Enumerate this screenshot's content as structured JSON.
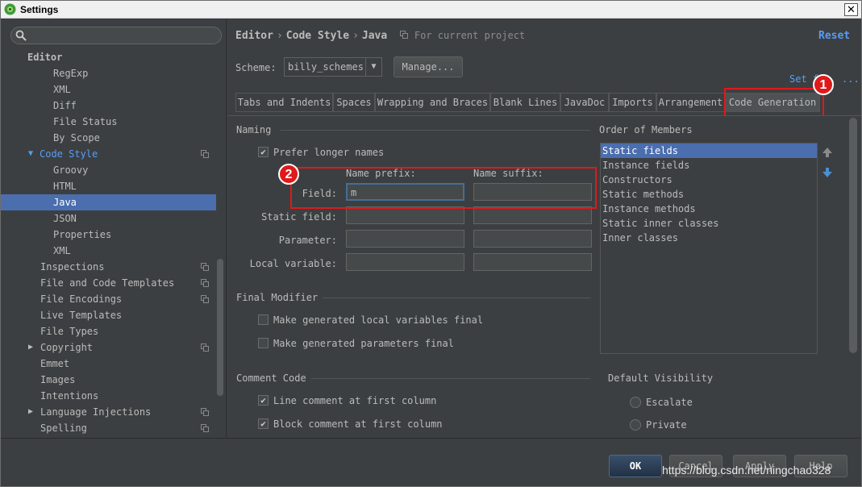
{
  "window": {
    "title": "Settings"
  },
  "search": {
    "placeholder": ""
  },
  "sidebar": {
    "items": [
      {
        "label": "Editor"
      },
      {
        "label": "RegExp"
      },
      {
        "label": "XML"
      },
      {
        "label": "Diff"
      },
      {
        "label": "File Status"
      },
      {
        "label": "By Scope"
      },
      {
        "label": "Code Style"
      },
      {
        "label": "Groovy"
      },
      {
        "label": "HTML"
      },
      {
        "label": "Java"
      },
      {
        "label": "JSON"
      },
      {
        "label": "Properties"
      },
      {
        "label": "XML"
      },
      {
        "label": "Inspections"
      },
      {
        "label": "File and Code Templates"
      },
      {
        "label": "File Encodings"
      },
      {
        "label": "Live Templates"
      },
      {
        "label": "File Types"
      },
      {
        "label": "Copyright"
      },
      {
        "label": "Emmet"
      },
      {
        "label": "Images"
      },
      {
        "label": "Intentions"
      },
      {
        "label": "Language Injections"
      },
      {
        "label": "Spelling"
      }
    ]
  },
  "header": {
    "crumb1": "Editor",
    "crumb2": "Code Style",
    "crumb3": "Java",
    "separator": "›",
    "project_note": "For current project",
    "reset": "Reset"
  },
  "scheme": {
    "label": "Scheme:",
    "value": "billy_schemes",
    "manage": "Manage...",
    "set_from": "Set f... ..."
  },
  "tabs": [
    {
      "label": "Tabs and Indents"
    },
    {
      "label": "Spaces"
    },
    {
      "label": "Wrapping and Braces"
    },
    {
      "label": "Blank Lines"
    },
    {
      "label": "JavaDoc"
    },
    {
      "label": "Imports"
    },
    {
      "label": "Arrangement"
    },
    {
      "label": "Code Generation"
    }
  ],
  "naming": {
    "title": "Naming",
    "prefer_longer": "Prefer longer names",
    "prefix_header": "Name prefix:",
    "suffix_header": "Name suffix:",
    "rows": [
      {
        "label": "Field:",
        "prefix": "m",
        "suffix": ""
      },
      {
        "label": "Static field:",
        "prefix": "",
        "suffix": ""
      },
      {
        "label": "Parameter:",
        "prefix": "",
        "suffix": ""
      },
      {
        "label": "Local variable:",
        "prefix": "",
        "suffix": ""
      }
    ]
  },
  "final_modifier": {
    "title": "Final Modifier",
    "local_vars": "Make generated local variables final",
    "params": "Make generated parameters final"
  },
  "order_of_members": {
    "title": "Order of Members",
    "items": [
      "Static fields",
      "Instance fields",
      "Constructors",
      "Static methods",
      "Instance methods",
      "Static inner classes",
      "Inner classes"
    ]
  },
  "comment_code": {
    "title": "Comment Code",
    "line_comment": "Line comment at first column",
    "block_comment": "Block comment at first column"
  },
  "default_visibility": {
    "title": "Default Visibility",
    "escalate": "Escalate",
    "private": "Private"
  },
  "annotations": {
    "badge1": "1",
    "badge2": "2"
  },
  "buttons": {
    "ok": "OK",
    "cancel": "Cancel",
    "apply": "Apply",
    "help": "Help"
  },
  "watermark": "https://blog.csdn.net/ningchao328",
  "colors": {
    "accent": "#589df6",
    "selection": "#4b6eaf",
    "annotation_red": "#e0191b",
    "background": "#3c3f41"
  }
}
